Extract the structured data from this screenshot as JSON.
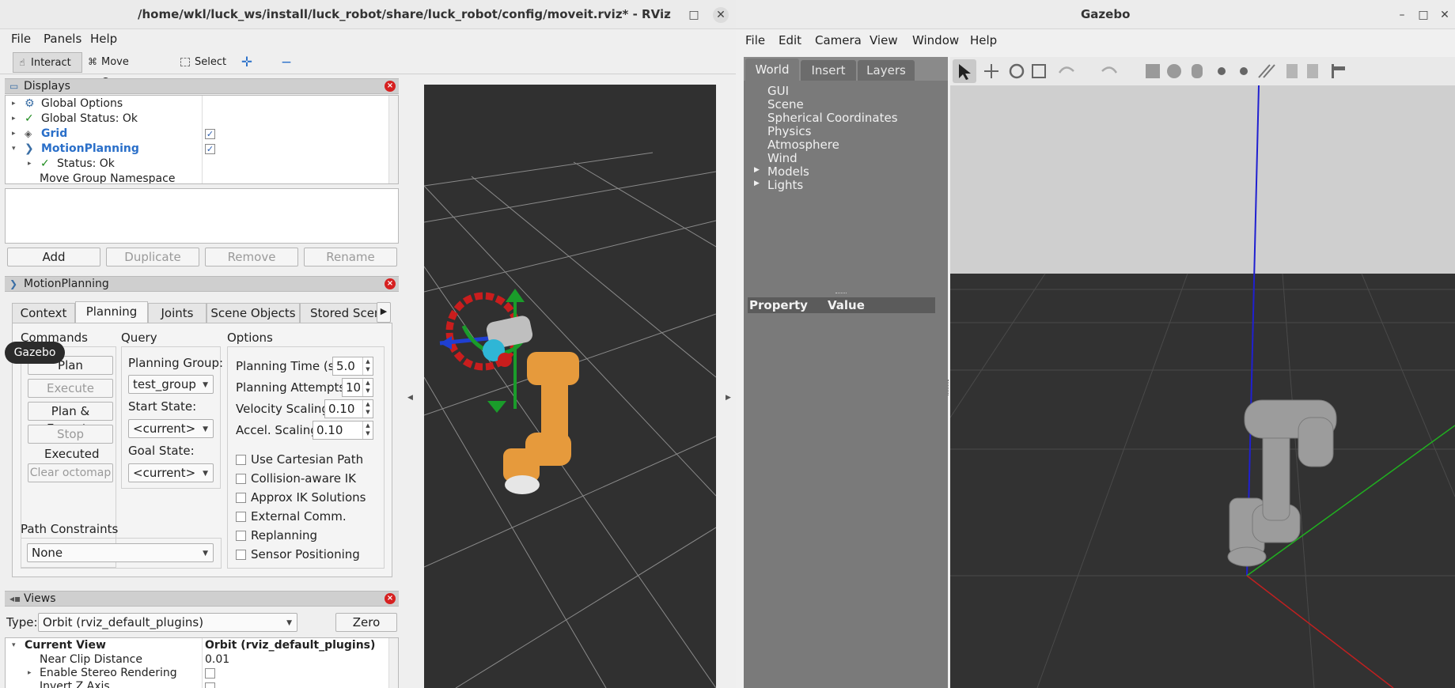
{
  "rviz": {
    "title": "/home/wkl/luck_ws/install/luck_robot/share/luck_robot/config/moveit.rviz* - RViz",
    "window_controls": [
      "–",
      "□",
      "✕"
    ],
    "menu": [
      "File",
      "Panels",
      "Help"
    ],
    "toolbar": {
      "interact": "Interact",
      "move_camera": "Move Camera",
      "select": "Select"
    },
    "displays": {
      "title": "Displays",
      "rows": [
        {
          "label": "Global Options"
        },
        {
          "label": "Global Status: Ok"
        },
        {
          "label": "Grid",
          "checked": true
        },
        {
          "label": "MotionPlanning",
          "checked": true
        },
        {
          "label": "Status: Ok"
        },
        {
          "label": "Move Group Namespace"
        }
      ],
      "buttons": [
        "Add",
        "Duplicate",
        "Remove",
        "Rename"
      ]
    },
    "motion_planning": {
      "title": "MotionPlanning",
      "tabs": [
        "Context",
        "Planning",
        "Joints",
        "Scene Objects",
        "Stored Scene"
      ],
      "selected_tab": "Planning",
      "commands": {
        "heading": "Commands",
        "plan": "Plan",
        "execute": "Execute",
        "plan_execute": "Plan & Execute",
        "stop": "Stop",
        "status": "Executed",
        "clear_octomap": "Clear octomap"
      },
      "query": {
        "heading": "Query",
        "planning_group_label": "Planning Group:",
        "planning_group": "test_group",
        "start_state_label": "Start State:",
        "start_state": "<current>",
        "goal_state_label": "Goal State:",
        "goal_state": "<current>"
      },
      "options": {
        "heading": "Options",
        "planning_time_label": "Planning Time (s):",
        "planning_time": "5.0",
        "planning_attempts_label": "Planning Attempts:",
        "planning_attempts": "10",
        "velocity_scaling_label": "Velocity Scaling:",
        "velocity_scaling": "0.10",
        "accel_scaling_label": "Accel. Scaling:",
        "accel_scaling": "0.10",
        "checkboxes": [
          "Use Cartesian Path",
          "Collision-aware IK",
          "Approx IK Solutions",
          "External Comm.",
          "Replanning",
          "Sensor Positioning"
        ]
      },
      "path_constraints_label": "Path Constraints",
      "path_constraints": "None"
    },
    "tooltip": "Gazebo",
    "views": {
      "title": "Views",
      "type_label": "Type:",
      "type_value": "Orbit (rviz_default_plugins)",
      "zero": "Zero",
      "rows": [
        {
          "label": "Current View",
          "value": "Orbit (rviz_default_plugins)"
        },
        {
          "label": "Near Clip Distance",
          "value": "0.01"
        },
        {
          "label": "Enable Stereo Rendering",
          "value": ""
        },
        {
          "label": "Invert Z Axis",
          "value": ""
        }
      ]
    }
  },
  "gazebo": {
    "title": "Gazebo",
    "window_controls": [
      "–",
      "□",
      "✕"
    ],
    "menu": [
      "File",
      "Edit",
      "Camera",
      "View",
      "Window",
      "Help"
    ],
    "tabs": [
      "World",
      "Insert",
      "Layers"
    ],
    "selected_tab": "World",
    "world_tree": [
      "GUI",
      "Scene",
      "Spherical Coordinates",
      "Physics",
      "Atmosphere",
      "Wind",
      "Models",
      "Lights"
    ],
    "property_header": {
      "property": "Property",
      "value": "Value"
    }
  },
  "colors": {
    "rviz_bg": "#efefef",
    "viewport_bg": "#303030",
    "gazebo_panel_bg": "#7a7a7a",
    "link_blue": "#2a6fc9",
    "robot_orange": "#e69a3c",
    "gazebo_sky": "#cfcfcf"
  }
}
